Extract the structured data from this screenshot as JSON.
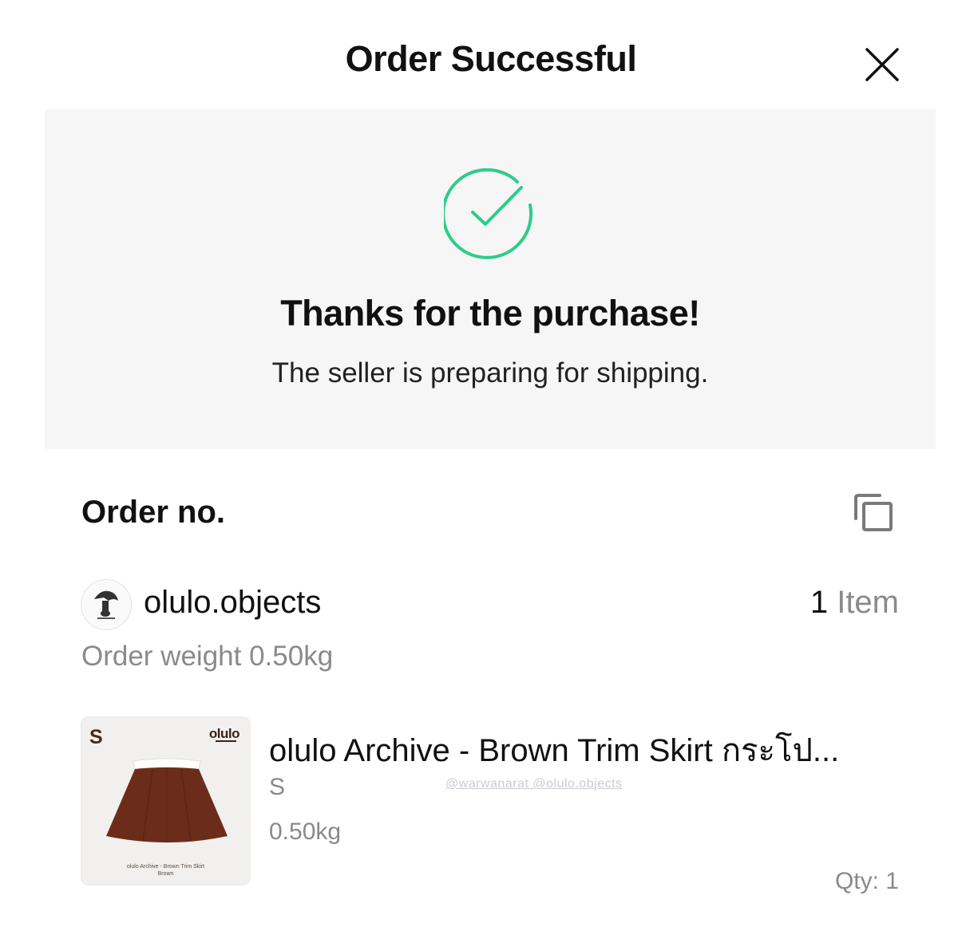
{
  "header": {
    "title": "Order Successful",
    "close_icon": "close-icon"
  },
  "success": {
    "icon": "check-circle-icon",
    "icon_color": "#2ecc8a",
    "title": "Thanks for the purchase!",
    "subtitle": "The seller is preparing for shipping."
  },
  "order": {
    "order_no_label": "Order no.",
    "copy_icon": "copy-icon",
    "shop_name": "olulo.objects",
    "item_count": "1",
    "item_unit": "Item",
    "order_weight": "Order weight 0.50kg"
  },
  "product": {
    "title": "olulo Archive - Brown Trim Skirt กระโป...",
    "variant": "S",
    "weight": "0.50kg",
    "qty": "Qty: 1",
    "watermark": "@warwanarat @olulo.objects",
    "thumbnail": {
      "size_label": "S",
      "brand": "olulo",
      "caption_line1": "olulo Archive - Brown Trim Skirt",
      "caption_line2": "Brown",
      "skirt_color": "#6b2d1a"
    }
  }
}
